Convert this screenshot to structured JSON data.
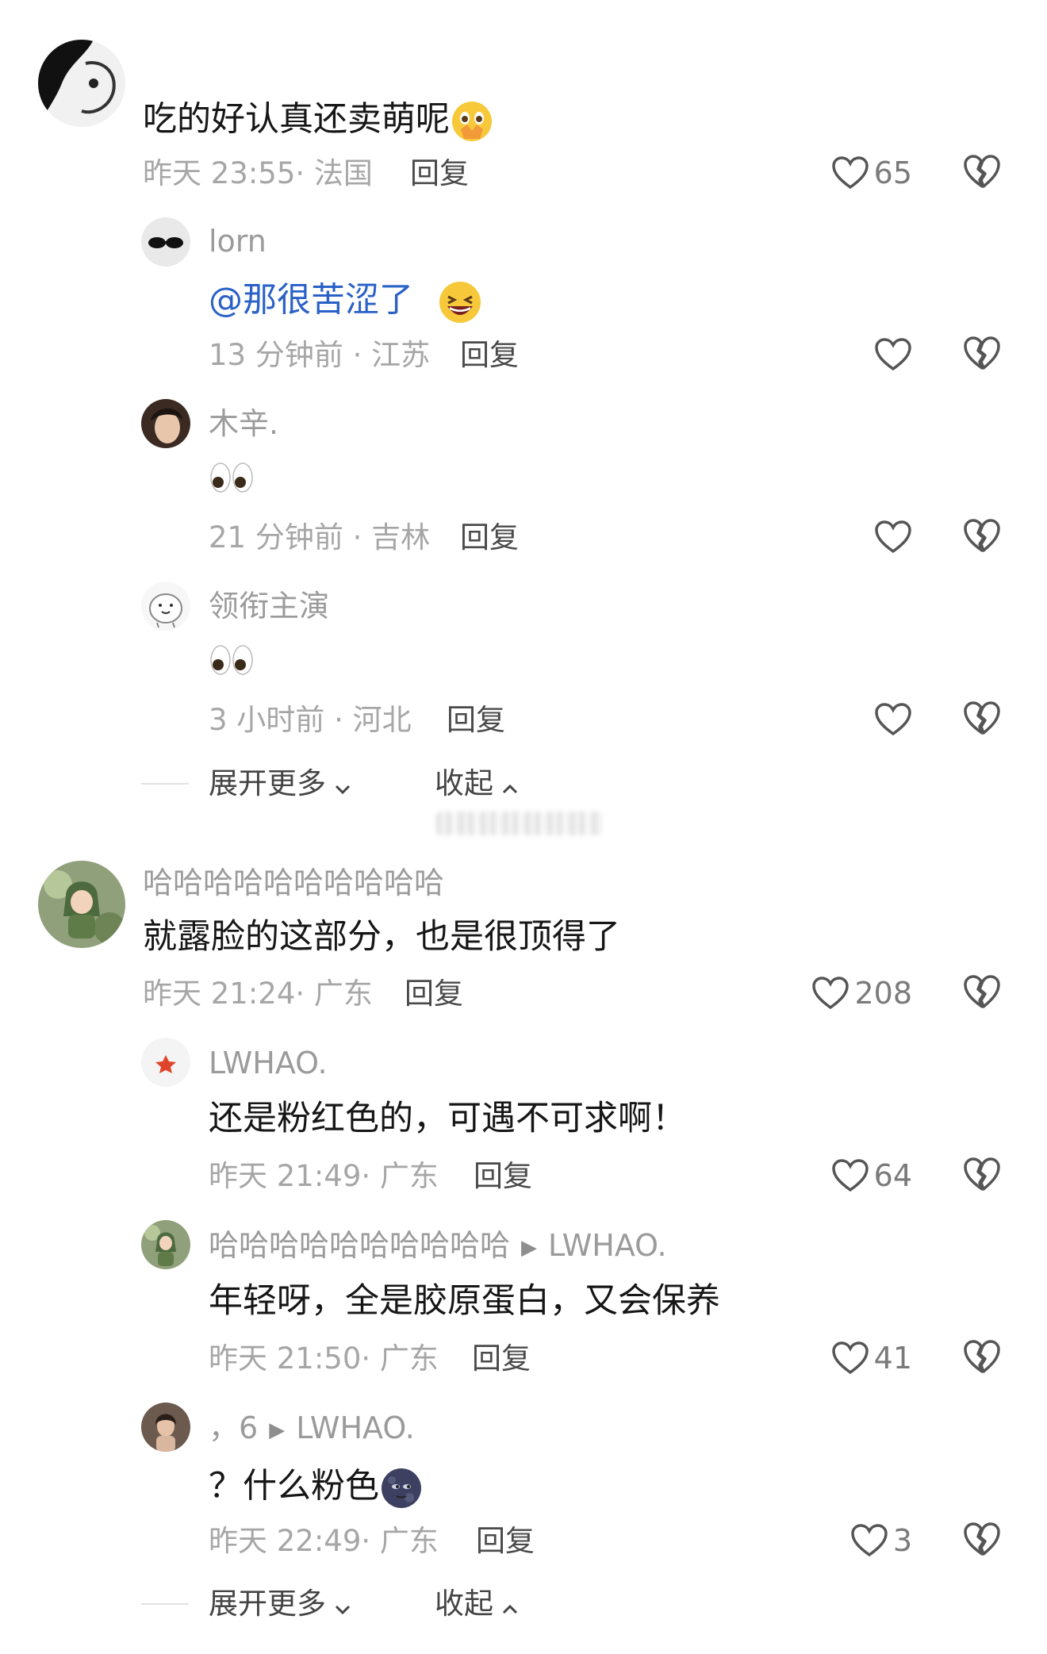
{
  "labels": {
    "reply": "回复",
    "expand_more": "展开更多",
    "collapse": "收起"
  },
  "threads": [
    {
      "comment": {
        "username": "",
        "text": "吃的好认真还卖萌呢",
        "emoji": "pleading-face-emoji",
        "time": "昨天 23:55",
        "location": "法国",
        "likes": "65"
      },
      "replies": [
        {
          "username": "lorn",
          "mention": "@那很苦涩了",
          "text": "",
          "emoji": "grinning-squint-emoji",
          "time": "13 分钟前",
          "location": "江苏",
          "likes": ""
        },
        {
          "username": "木辛.",
          "text": "",
          "emoji": "eyes-emoji",
          "time": "21 分钟前",
          "location": "吉林",
          "likes": ""
        },
        {
          "username": "领衔主演",
          "text": "",
          "emoji": "eyes-emoji",
          "time": "3 小时前",
          "location": "河北",
          "likes": ""
        }
      ]
    },
    {
      "comment": {
        "username": "哈哈哈哈哈哈哈哈哈哈",
        "text": "就露脸的这部分，也是很顶得了",
        "time": "昨天 21:24",
        "location": "广东",
        "likes": "208"
      },
      "replies": [
        {
          "username": "LWHAO.",
          "text": "还是粉红色的，可遇不可求啊！",
          "time": "昨天 21:49",
          "location": "广东",
          "likes": "64"
        },
        {
          "username": "哈哈哈哈哈哈哈哈哈哈",
          "reply_to": "LWHAO.",
          "text": "年轻呀，全是胶原蛋白，又会保养",
          "time": "昨天 21:50",
          "location": "广东",
          "likes": "41"
        },
        {
          "username": "，6",
          "reply_to": "LWHAO.",
          "text": "？什么粉色",
          "emoji": "new-moon-face-emoji",
          "time": "昨天 22:49",
          "location": "广东",
          "likes": "3"
        }
      ]
    }
  ],
  "colors": {
    "mention": "#2a61c7",
    "meta_gray": "#a6a6a6",
    "username_gray": "#9b9b9b"
  }
}
